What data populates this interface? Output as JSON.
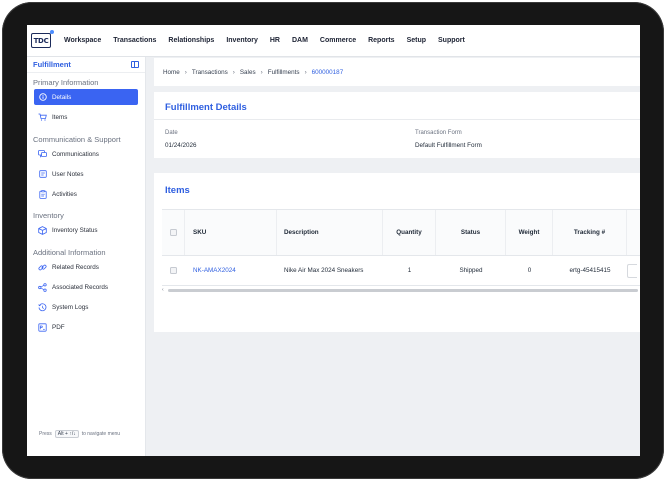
{
  "nav": {
    "logo": "TDC",
    "items": [
      "Workspace",
      "Transactions",
      "Relationships",
      "Inventory",
      "HR",
      "DAM",
      "Commerce",
      "Reports",
      "Setup",
      "Support"
    ]
  },
  "sidebar": {
    "title": "Fulfillment",
    "sections": [
      {
        "label": "Primary Information",
        "items": [
          {
            "label": "Details",
            "icon": "info-icon",
            "active": true
          },
          {
            "label": "Items",
            "icon": "cart-icon",
            "active": false
          }
        ]
      },
      {
        "label": "Communication & Support",
        "items": [
          {
            "label": "Communications",
            "icon": "chat-icon",
            "active": false
          },
          {
            "label": "User Notes",
            "icon": "note-icon",
            "active": false
          },
          {
            "label": "Activities",
            "icon": "clipboard-icon",
            "active": false
          }
        ]
      },
      {
        "label": "Inventory",
        "items": [
          {
            "label": "Inventory Status",
            "icon": "box-icon",
            "active": false
          }
        ]
      },
      {
        "label": "Additional Information",
        "items": [
          {
            "label": "Related Records",
            "icon": "link-icon",
            "active": false
          },
          {
            "label": "Associated Records",
            "icon": "share-icon",
            "active": false
          },
          {
            "label": "System Logs",
            "icon": "history-icon",
            "active": false
          },
          {
            "label": "PDF",
            "icon": "pdf-icon",
            "active": false
          }
        ]
      }
    ],
    "footer": {
      "prefix": "Press",
      "keys": "Alt + ↑/↓",
      "suffix": "to navigate menu"
    }
  },
  "breadcrumb": [
    "Home",
    "Transactions",
    "Sales",
    "Fulfillments",
    "600000187"
  ],
  "details": {
    "title": "Fulfillment Details",
    "date_label": "Date",
    "date_value": "01/24/2026",
    "form_label": "Transaction Form",
    "form_value": "Default Fulfillment Form"
  },
  "items": {
    "title": "Items",
    "columns": [
      "SKU",
      "Description",
      "Quantity",
      "Status",
      "Weight",
      "Tracking #"
    ],
    "rows": [
      {
        "sku": "NK-AMAX2024",
        "description": "Nike Air Max 2024 Sneakers",
        "quantity": "1",
        "status": "Shipped",
        "weight": "0",
        "tracking": "ertg-45415415"
      }
    ]
  },
  "colors": {
    "accent": "#3a64f2",
    "link": "#2f5fe0",
    "bezel": "#161616",
    "background": "#eef0f3"
  }
}
